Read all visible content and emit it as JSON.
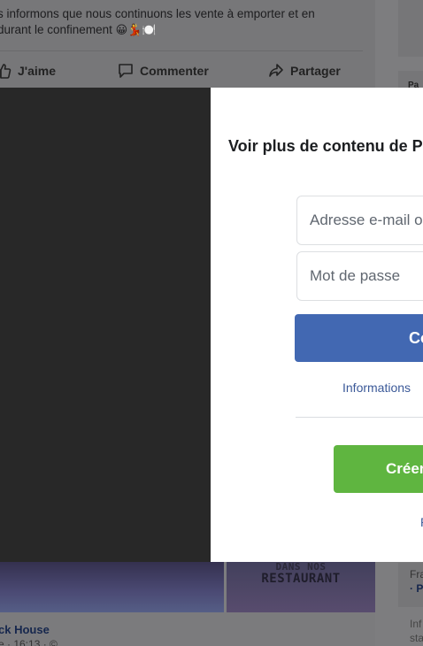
{
  "post": {
    "text_line1": "s informons que nous continuons les vente à emporter et en",
    "text_line2": "durant le confinement",
    "emojis": "😀💃🍽️",
    "actions": {
      "like": "J'aime",
      "comment": "Commenter",
      "share": "Partager"
    }
  },
  "right_column": {
    "card_label": "Pa",
    "fr_text": "Fra",
    "fr_dot": "· P",
    "info_line1": "Inf",
    "info_line2": "sta"
  },
  "banner": {
    "right_line1": "DANS NOS",
    "right_line2": "RESTAURANT"
  },
  "below_post": {
    "page_name": "ck House",
    "time": "e · 16:13 · ©"
  },
  "modal": {
    "title": "Voir plus de contenu de P",
    "email_placeholder": "Adresse e-mail o",
    "password_placeholder": "Mot de passe",
    "login_label": "Co",
    "forgot_label": "Informations",
    "create_label": "Créer",
    "more_link": "P"
  },
  "colors": {
    "login_button": "#4268b2",
    "create_button": "#5fb540",
    "link": "#3b5998",
    "overlay": "#282828"
  }
}
